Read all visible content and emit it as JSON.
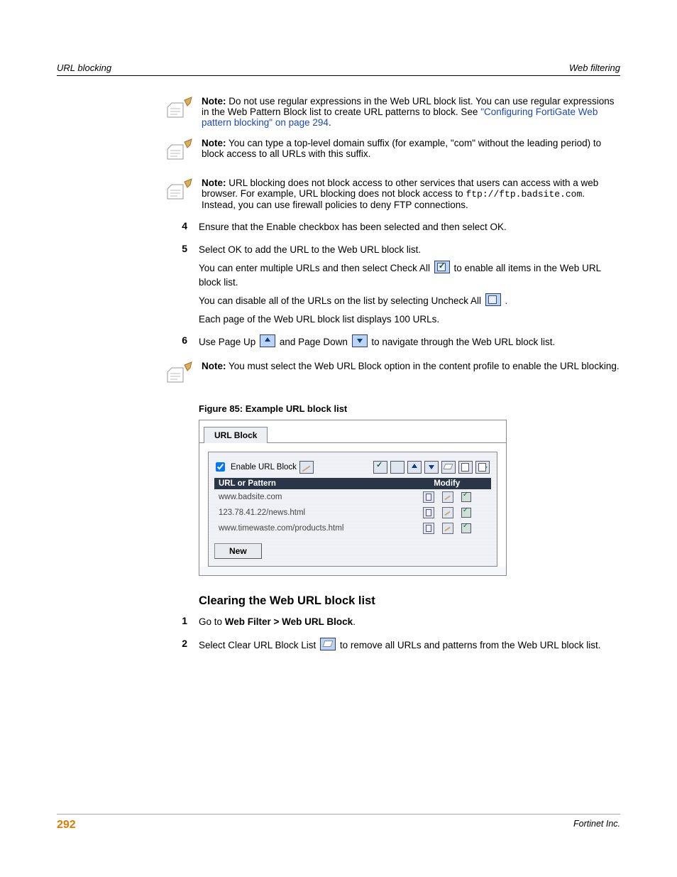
{
  "header": {
    "left": "URL blocking",
    "right": "Web filtering"
  },
  "notes": {
    "n1_bold": "Note:",
    "n1_a": " Do not use regular expressions in the Web URL block list. You can use regular expressions in the Web Pattern Block list to create URL patterns to block. See ",
    "n1_link": "\"Configuring FortiGate Web pattern blocking\" on page 294",
    "n1_c": ".",
    "n2_bold": "Note:",
    "n2": " You can type a top-level domain suffix (for example, \"com\" without the leading period) to block access to all URLs with this suffix.",
    "n3_bold": "Note:",
    "n3_a": " URL blocking does not block access to other services that users can access with a web browser. For example, URL blocking does not block access to ",
    "n3_code": "ftp://ftp.badsite.com",
    "n3_b": ". Instead, you can use firewall policies to deny FTP connections.",
    "n4_bold": "Note:",
    "n4": " You must select the Web URL Block option in the content profile to enable the URL blocking."
  },
  "steps": {
    "s4": {
      "num": "4",
      "text": "Ensure that the Enable checkbox has been selected and then select OK."
    },
    "s5": {
      "num": "5",
      "l1": "Select OK to add the URL to the Web URL block list.",
      "l2a": "You can enter multiple URLs and then select Check All ",
      "l2b": " to enable all items in the Web URL block list.",
      "l3a": "You can disable all of the URLs on the list by selecting Uncheck All ",
      "l3b": " .",
      "l4": "Each page of the Web URL block list displays 100 URLs."
    },
    "s6": {
      "num": "6",
      "a": "Use Page Up ",
      "b": " and Page Down ",
      "c": " to navigate through the Web URL block list."
    }
  },
  "figure": {
    "caption": "Figure 85: Example URL block list"
  },
  "mock": {
    "tab": "URL Block",
    "enable": "Enable URL Block",
    "th1": "URL or Pattern",
    "th2": "Modify",
    "rows": [
      "www.badsite.com",
      "123.78.41.22/news.html",
      "www.timewaste.com/products.html"
    ],
    "new_btn": "New"
  },
  "section2": {
    "heading": "Clearing the Web URL block list",
    "s1": {
      "num": "1",
      "a": "Go to ",
      "bold": "Web Filter > Web URL Block",
      "b": "."
    },
    "s2": {
      "num": "2",
      "a": "Select Clear URL Block List ",
      "b": " to remove all URLs and patterns from the Web URL block list."
    }
  },
  "footer": {
    "pagenum": "292",
    "copyright": "Fortinet Inc."
  }
}
